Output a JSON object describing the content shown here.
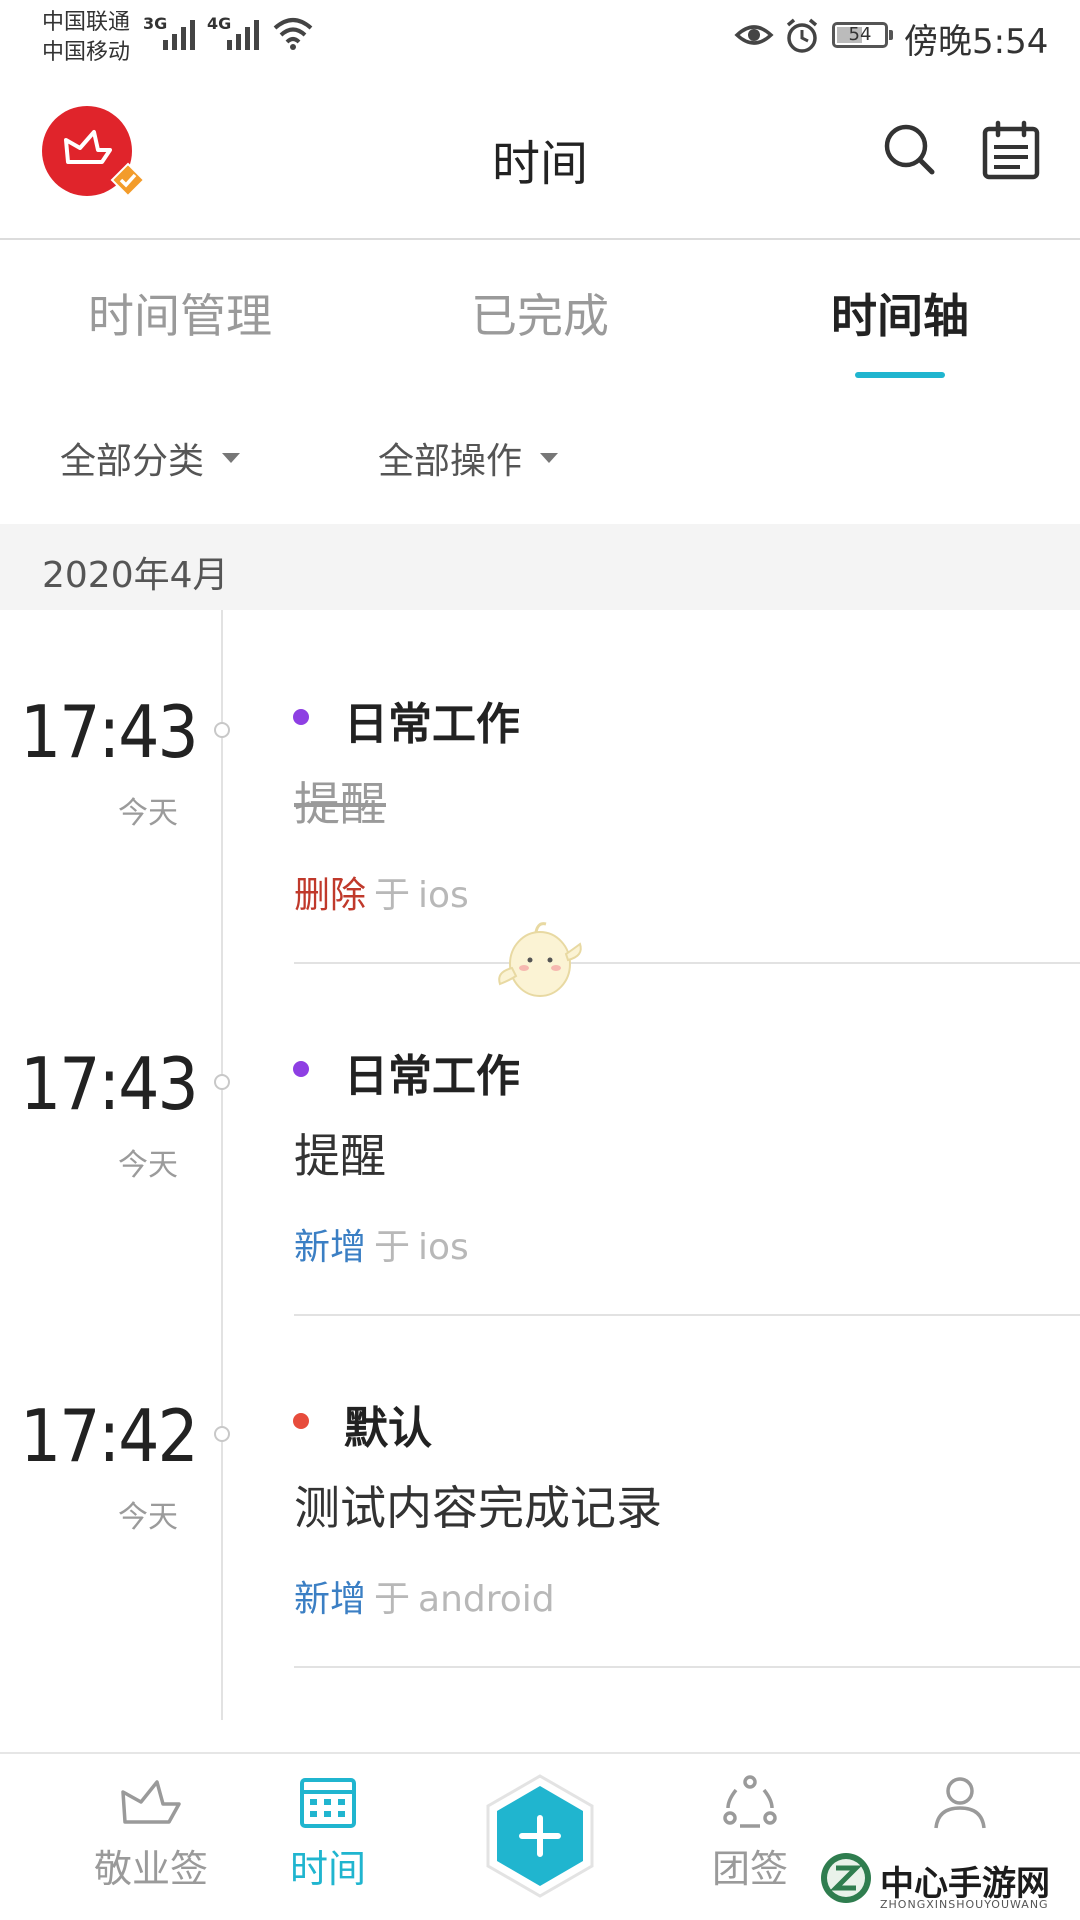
{
  "status_bar": {
    "carrier_1": "中国联通",
    "carrier_2": "中国移动",
    "network_1": "3G",
    "network_2": "4G",
    "battery_percent": "54",
    "battery_level": 0.54,
    "clock": "傍晚5:54",
    "icons": [
      "signal-icon",
      "wifi-icon",
      "eye-icon",
      "alarm-icon",
      "battery-icon"
    ]
  },
  "header": {
    "title": "时间",
    "logo_icon": "app-logo",
    "right_icons": [
      "search-icon",
      "calendar-icon"
    ]
  },
  "tabs": [
    {
      "label": "时间管理",
      "active": false
    },
    {
      "label": "已完成",
      "active": false
    },
    {
      "label": "时间轴",
      "active": true
    }
  ],
  "filters": {
    "category": "全部分类",
    "operation": "全部操作"
  },
  "month": "2020年4月",
  "entries": [
    {
      "time": "17:43",
      "day": "今天",
      "category": "日常工作",
      "category_color": "#8e3fe3",
      "title": "提醒",
      "struck": true,
      "action": "删除",
      "action_color": "#c0392b",
      "on": "于",
      "platform": "ios"
    },
    {
      "time": "17:43",
      "day": "今天",
      "category": "日常工作",
      "category_color": "#8e3fe3",
      "title": "提醒",
      "struck": false,
      "action": "新增",
      "action_color": "#3b7fc4",
      "on": "于",
      "platform": "ios"
    },
    {
      "time": "17:42",
      "day": "今天",
      "category": "默认",
      "category_color": "#e74c3c",
      "title": "测试内容完成记录",
      "struck": false,
      "action": "新增",
      "action_color": "#3b7fc4",
      "on": "于",
      "platform": "android"
    }
  ],
  "bottom_nav": [
    {
      "label": "敬业签",
      "icon": "note-icon",
      "active": false
    },
    {
      "label": "时间",
      "icon": "calendar-grid-icon",
      "active": true
    },
    {
      "label": "",
      "icon": "add-icon",
      "active": false
    },
    {
      "label": "团签",
      "icon": "team-icon",
      "active": false
    },
    {
      "label": "",
      "icon": "user-icon",
      "active": false
    }
  ],
  "watermark": {
    "text": "中心手游网",
    "sub": "ZHONGXINSHOUYOUWANG"
  },
  "colors": {
    "accent": "#20b5cf",
    "logo": "#e0242b"
  }
}
